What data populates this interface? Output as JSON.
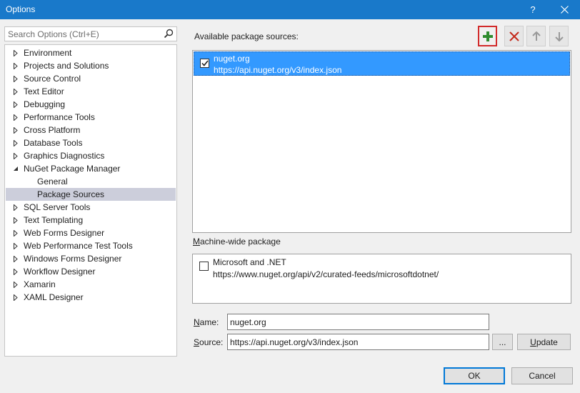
{
  "window": {
    "title": "Options",
    "help_label": "?",
    "close_label": "✕"
  },
  "search": {
    "placeholder": "Search Options (Ctrl+E)"
  },
  "tree": {
    "items": [
      {
        "label": "Environment"
      },
      {
        "label": "Projects and Solutions"
      },
      {
        "label": "Source Control"
      },
      {
        "label": "Text Editor"
      },
      {
        "label": "Debugging"
      },
      {
        "label": "Performance Tools"
      },
      {
        "label": "Cross Platform"
      },
      {
        "label": "Database Tools"
      },
      {
        "label": "Graphics Diagnostics"
      },
      {
        "label": "NuGet Package Manager"
      },
      {
        "label": "General"
      },
      {
        "label": "Package Sources"
      },
      {
        "label": "SQL Server Tools"
      },
      {
        "label": "Text Templating"
      },
      {
        "label": "Web Forms Designer"
      },
      {
        "label": "Web Performance Test Tools"
      },
      {
        "label": "Windows Forms Designer"
      },
      {
        "label": "Workflow Designer"
      },
      {
        "label": "Xamarin"
      },
      {
        "label": "XAML Designer"
      }
    ]
  },
  "available_sources": {
    "label": "Available package sources:",
    "items": [
      {
        "name": "nuget.org",
        "url": "https://api.nuget.org/v3/index.json",
        "checked": true
      }
    ]
  },
  "machine_sources": {
    "label_prefix": "M",
    "label_rest": "achine-wide package",
    "items": [
      {
        "name": "Microsoft and .NET",
        "url": "https://www.nuget.org/api/v2/curated-feeds/microsoftdotnet/",
        "checked": false
      }
    ]
  },
  "form": {
    "name_label_u": "N",
    "name_label_rest": "ame:",
    "name_value": "nuget.org",
    "source_label_u": "S",
    "source_label_rest": "ource:",
    "source_value": "https://api.nuget.org/v3/index.json",
    "browse_label": "...",
    "update_label_u": "U",
    "update_label_rest": "pdate"
  },
  "buttons": {
    "ok_label": "OK",
    "cancel_label": "Cancel"
  },
  "colors": {
    "titlebar": "#1979ca",
    "selection": "#3399ff",
    "add_icon": "#2e8b2e",
    "remove_icon": "#c42b1c",
    "highlight_border": "#d22b2b"
  }
}
